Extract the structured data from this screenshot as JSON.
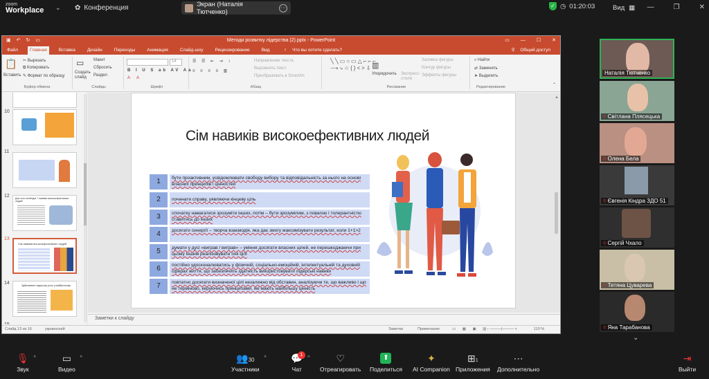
{
  "topbar": {
    "logo_top": "zoom",
    "logo_bottom": "Workplace",
    "conference": "Конференция",
    "screen_share": "Экран (Наталія Тютченко)",
    "timer": "01:20:03",
    "view": "Вид"
  },
  "ppt": {
    "title": "Методи розвитку лідерства (2).pptx - PowerPoint",
    "tabs": [
      "Файл",
      "Главная",
      "Вставка",
      "Дизайн",
      "Переходы",
      "Анимация",
      "Слайд-шоу",
      "Рецензирование",
      "Вид"
    ],
    "tell_me": "Что вы хотите сделать?",
    "share": "Общий доступ",
    "ribbon": {
      "paste": "Вставить",
      "cut": "Вырезать",
      "copy": "Копировать",
      "format_painter": "Формат по образцу",
      "clipboard": "Буфер обмена",
      "create_slide": "Создать слайд",
      "layout": "Макет",
      "reset": "Сбросить",
      "section": "Раздел",
      "slides": "Слайды",
      "font": "Шрифт",
      "font_size": "14",
      "text_direction": "Направление текста",
      "align_text": "Выровнять текст",
      "smartart": "Преобразовать в SmartArt",
      "paragraph": "Абзац",
      "arrange": "Упорядочить",
      "quick_styles": "Экспресс-стили",
      "shape_fill": "Заливка фигуры",
      "shape_outline": "Контур фигуры",
      "shape_effects": "Эффекты фигуры",
      "drawing": "Рисование",
      "find": "Найти",
      "replace": "Заменить",
      "select": "Выделить",
      "editing": "Редактирование"
    },
    "slide_numbers": [
      "10",
      "11",
      "12",
      "13",
      "14",
      "15"
    ],
    "thumb_titles": {
      "t11": "",
      "t12": "Для чого необхідні 7 навиків високоефективних людей",
      "t13": "Сім навиків високоефективних людей",
      "t14": "Здійснювати лідерську роль у майбутньому"
    },
    "slide": {
      "title": "Сім навиків високоефективних людей",
      "rows": [
        {
          "n": "1",
          "text": "бути проактивним, усвідомлювати свободу вибору та відповідальність за нього на основі власних принципів і цінностей"
        },
        {
          "n": "2",
          "text": "починати справу, уявляючи кінцеву ціль"
        },
        {
          "n": "3",
          "text": "спочатку намагатися зрозуміти інших, потім – бути зрозумілим, з повагою і толерантністю ставитись до інших"
        },
        {
          "n": "4",
          "text": "досягати синергії – творча взаємодія, яка дає змогу максимізувати результат, коли 1+1>2"
        },
        {
          "n": "5",
          "text": "думати у дусі «виграв / виграв» – уміння досягати власних цілей, не перешкоджаючи при цьому іншим реалізовувати їхні цілі"
        },
        {
          "n": "6",
          "text": "постійно удосконалюватись у фізичній, соціально-емоційній, інтелектуальній та духовній сферах життя, що забезпечить здатність використовувати лідерські навики"
        },
        {
          "n": "7",
          "text": "повтатно досягати визначеної цілі незалежно від обставин, аналізуючи те, що важливо і що не терміново, керуючись принципами, які мають найбільшу цінність"
        }
      ]
    },
    "notes": "Заметки к слайду",
    "status_left": "Слайд 13 из 16",
    "language": "украинский",
    "status_notes": "Заметки",
    "status_comments": "Примечания",
    "zoom": "110 %"
  },
  "participants": [
    {
      "name": "Наталія Тютченко",
      "muted": false
    },
    {
      "name": "Світлана Плясецька",
      "muted": true
    },
    {
      "name": "Олена Бела",
      "muted": true
    },
    {
      "name": "Євгенія Кіндра ЗДО 51",
      "muted": true
    },
    {
      "name": "Сергій Чхало",
      "muted": true
    },
    {
      "name": "Тетяна Цуварева",
      "muted": true
    },
    {
      "name": "Яна Тарабанова",
      "muted": true
    }
  ],
  "bottombar": {
    "audio": "Звук",
    "video": "Видео",
    "participants": "Участники",
    "participants_count": "30",
    "chat": "Чат",
    "chat_badge": "1",
    "react": "Отреагировать",
    "share": "Поделиться",
    "ai": "AI Companion",
    "apps": "Приложения",
    "apps_count": "1",
    "more": "Дополнительно",
    "exit": "Выйти"
  }
}
